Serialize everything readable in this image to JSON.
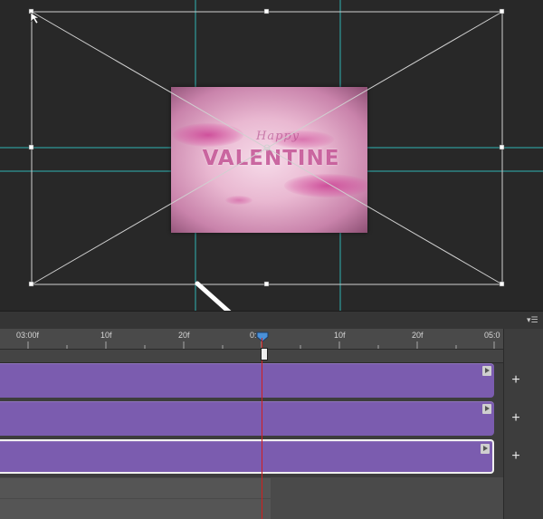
{
  "document": {
    "title_small": "Happy",
    "title_main": "VALENTINE"
  },
  "timeline": {
    "ruler_labels": [
      "03:00f",
      "10f",
      "20f",
      "0:00f",
      "10f",
      "20f",
      "05:0"
    ],
    "tracks": [
      {
        "selected": false,
        "add_label": "+"
      },
      {
        "selected": false,
        "add_label": "+"
      },
      {
        "selected": true,
        "add_label": "+"
      }
    ],
    "panel_menu_icon": "panel-menu-icon"
  },
  "colors": {
    "guide": "#2fb5b5",
    "track": "#7b5caf",
    "playhead": "#d21e1e"
  }
}
